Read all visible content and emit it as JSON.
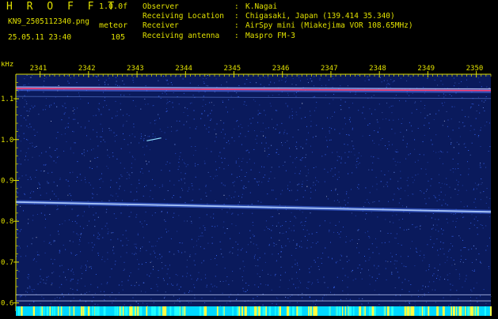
{
  "header": {
    "app_title": "H R O F F T",
    "version": "1.0.0f",
    "filename": "KN9_2505112340.png",
    "mode": "meteor",
    "datetime": "25.05.11 23:40",
    "count": "105",
    "meta": [
      {
        "key": "Observer",
        "value": "K.Nagai"
      },
      {
        "key": "Receiving Location",
        "value": "Chigasaki, Japan (139.414 35.340)"
      },
      {
        "key": "Receiver",
        "value": "AirSpy mini (Miakejima VOR 108.65MHz)"
      },
      {
        "key": "Receiving antenna",
        "value": "Maspro FM-3"
      }
    ],
    "separator": ":"
  },
  "chart_data": {
    "type": "heatmap",
    "ylabel": "kHz",
    "x_ticks": [
      "2341",
      "2342",
      "2343",
      "2344",
      "2345",
      "2346",
      "2347",
      "2348",
      "2349",
      "2350"
    ],
    "y_ticks": [
      "1.1",
      "1.0",
      "0.9",
      "0.8",
      "0.7",
      "0.6"
    ],
    "y_tick_values": [
      1.1,
      1.0,
      0.9,
      0.8,
      0.7,
      0.6
    ],
    "ylim": [
      0.58,
      1.16
    ],
    "xlim": [
      2340.5,
      2350.3
    ],
    "traces": [
      {
        "name": "carrier",
        "x_start": 2340.5,
        "x_end": 2350.3,
        "y_start": 1.125,
        "y_end": 1.12
      },
      {
        "name": "doppler",
        "x_start": 2340.5,
        "x_end": 2350.3,
        "y_start": 0.847,
        "y_end": 0.823
      },
      {
        "name": "meteor",
        "x_start": 2343.2,
        "x_end": 2343.5,
        "y_start": 0.997,
        "y_end": 1.004
      }
    ],
    "colors": {
      "background": "#0a1a5c",
      "noise": "#3c6cff",
      "strong": "#ffffff",
      "peak": "#ff4070",
      "axis": "#e0e000",
      "base": "#00d8ff"
    }
  }
}
